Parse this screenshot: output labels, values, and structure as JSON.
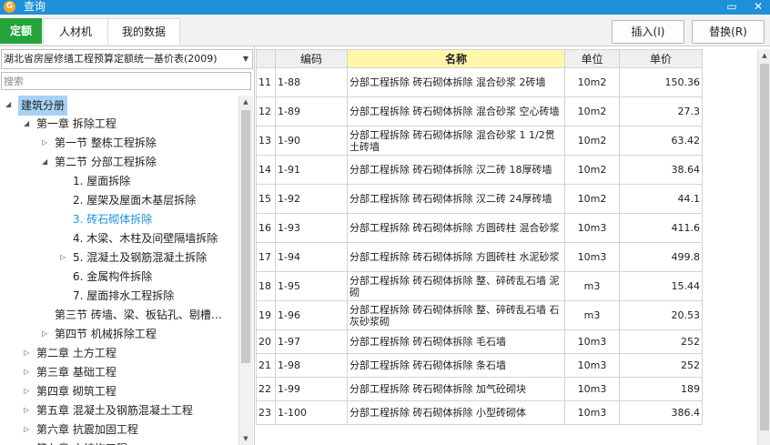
{
  "window": {
    "title": "查询",
    "minimize": "▭",
    "close": "✕"
  },
  "toolbar": {
    "tabs": [
      {
        "label": "定额",
        "active": true
      },
      {
        "label": "人材机",
        "active": false
      },
      {
        "label": "我的数据",
        "active": false
      }
    ],
    "insert_label": "插入(I)",
    "replace_label": "替换(R)"
  },
  "left_panel": {
    "library": "湖北省房屋修缮工程预算定额统一基价表(2009)",
    "search_placeholder": "搜索",
    "tree": [
      {
        "label": "建筑分册",
        "level": 0,
        "toggle": "◢",
        "selected": true
      },
      {
        "label": "第一章 拆除工程",
        "level": 1,
        "toggle": "◢"
      },
      {
        "label": "第一节 整栋工程拆除",
        "level": 2,
        "toggle": "▷"
      },
      {
        "label": "第二节 分部工程拆除",
        "level": 2,
        "toggle": "◢"
      },
      {
        "label": "1. 屋面拆除",
        "level": 3,
        "toggle": ""
      },
      {
        "label": "2. 屋架及屋面木基层拆除",
        "level": 3,
        "toggle": ""
      },
      {
        "label": "3. 砖石砌体拆除",
        "level": 3,
        "toggle": "",
        "current": true
      },
      {
        "label": "4. 木梁、木柱及间壁隔墙拆除",
        "level": 3,
        "toggle": ""
      },
      {
        "label": "5. 混凝土及钢筋混凝土拆除",
        "level": 3,
        "toggle": "▷"
      },
      {
        "label": "6. 金属构件拆除",
        "level": 3,
        "toggle": ""
      },
      {
        "label": "7. 屋面排水工程拆除",
        "level": 3,
        "toggle": ""
      },
      {
        "label": "第三节 砖墙、梁、板钻孔、剔槽…",
        "level": 2,
        "toggle": ""
      },
      {
        "label": "第四节 机械拆除工程",
        "level": 2,
        "toggle": "▷"
      },
      {
        "label": "第二章 土方工程",
        "level": 1,
        "toggle": "▷"
      },
      {
        "label": "第三章 基础工程",
        "level": 1,
        "toggle": "▷"
      },
      {
        "label": "第四章 砌筑工程",
        "level": 1,
        "toggle": "▷"
      },
      {
        "label": "第五章 混凝土及钢筋混凝土工程",
        "level": 1,
        "toggle": "▷"
      },
      {
        "label": "第六章 抗震加固工程",
        "level": 1,
        "toggle": "▷"
      },
      {
        "label": "第七章 木结构工程",
        "level": 1,
        "toggle": "▷"
      }
    ]
  },
  "grid": {
    "columns": [
      "",
      "编码",
      "名称",
      "单位",
      "单价"
    ],
    "rows": [
      {
        "n": "11",
        "code": "1-88",
        "name": "分部工程拆除 砖石砌体拆除 混合砂浆 2砖墙",
        "unit": "10m2",
        "price": "150.36"
      },
      {
        "n": "12",
        "code": "1-89",
        "name": "分部工程拆除 砖石砌体拆除 混合砂浆 空心砖墙",
        "unit": "10m2",
        "price": "27.3"
      },
      {
        "n": "13",
        "code": "1-90",
        "name": "分部工程拆除 砖石砌体拆除 混合砂浆 1 1/2贯土砖墙",
        "unit": "10m2",
        "price": "63.42"
      },
      {
        "n": "14",
        "code": "1-91",
        "name": "分部工程拆除 砖石砌体拆除 汉二砖 18厚砖墙",
        "unit": "10m2",
        "price": "38.64"
      },
      {
        "n": "15",
        "code": "1-92",
        "name": "分部工程拆除 砖石砌体拆除 汉二砖 24厚砖墙",
        "unit": "10m2",
        "price": "44.1"
      },
      {
        "n": "16",
        "code": "1-93",
        "name": "分部工程拆除 砖石砌体拆除 方圆砖柱 混合砂浆",
        "unit": "10m3",
        "price": "411.6"
      },
      {
        "n": "17",
        "code": "1-94",
        "name": "分部工程拆除 砖石砌体拆除 方圆砖柱 水泥砂浆",
        "unit": "10m3",
        "price": "499.8"
      },
      {
        "n": "18",
        "code": "1-95",
        "name": "分部工程拆除 砖石砌体拆除 整、碎砖乱石墙 泥砌",
        "unit": "m3",
        "price": "15.44"
      },
      {
        "n": "19",
        "code": "1-96",
        "name": "分部工程拆除 砖石砌体拆除 整、碎砖乱石墙 石灰砂浆砌",
        "unit": "m3",
        "price": "20.53"
      },
      {
        "n": "20",
        "code": "1-97",
        "name": "分部工程拆除 砖石砌体拆除 毛石墙",
        "unit": "10m3",
        "price": "252"
      },
      {
        "n": "21",
        "code": "1-98",
        "name": "分部工程拆除 砖石砌体拆除 条石墙",
        "unit": "10m3",
        "price": "252"
      },
      {
        "n": "22",
        "code": "1-99",
        "name": "分部工程拆除 砖石砌体拆除 加气砼砌块",
        "unit": "10m3",
        "price": "189"
      },
      {
        "n": "23",
        "code": "1-100",
        "name": "分部工程拆除 砖石砌体拆除 小型砖砌体",
        "unit": "10m3",
        "price": "386.4"
      }
    ]
  }
}
